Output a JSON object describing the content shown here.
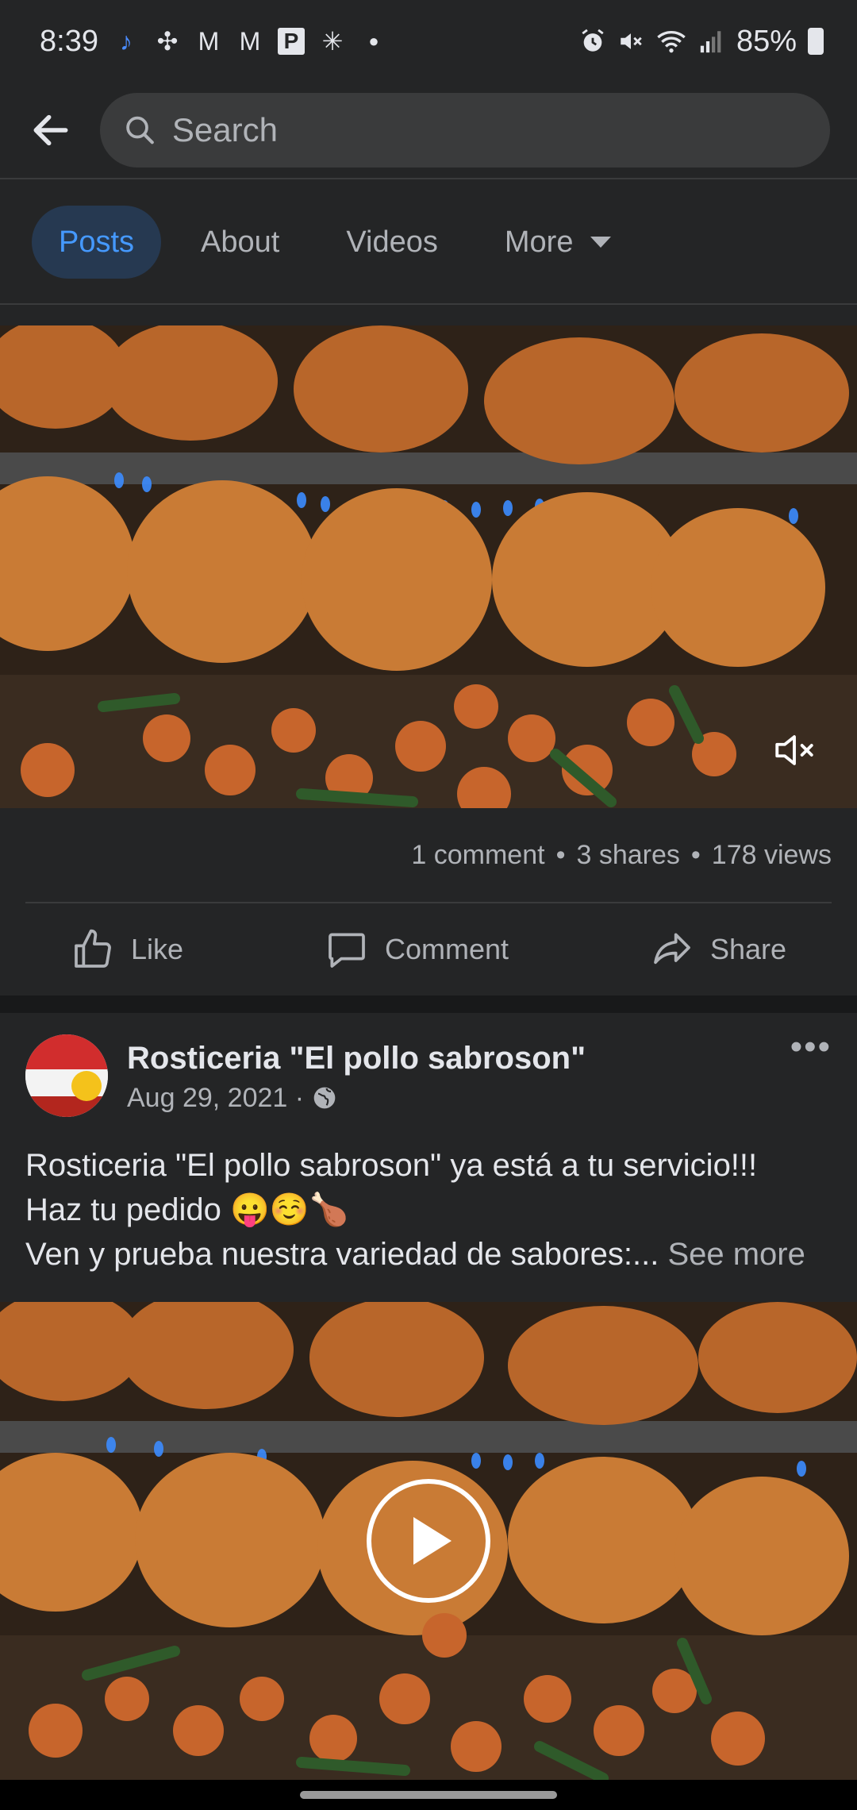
{
  "status_bar": {
    "time": "8:39",
    "battery": "85%",
    "left_icons": [
      "music-note-icon",
      "pinwheel-icon",
      "gmail-icon",
      "gmail-icon",
      "parking-icon",
      "walmart-spark-icon",
      "dot-icon"
    ],
    "right_icons": [
      "alarm-icon",
      "mute-icon",
      "wifi-icon",
      "signal-icon",
      "battery-icon"
    ]
  },
  "header": {
    "search_placeholder": "Search"
  },
  "tabs": [
    {
      "label": "Posts",
      "active": true
    },
    {
      "label": "About",
      "active": false
    },
    {
      "label": "Videos",
      "active": false
    },
    {
      "label": "More",
      "active": false
    }
  ],
  "post1": {
    "stats": {
      "comments": "1 comment",
      "shares": "3 shares",
      "views": "178 views",
      "separator": "•"
    },
    "actions": {
      "like": "Like",
      "comment": "Comment",
      "share": "Share"
    }
  },
  "post2": {
    "author": "Rosticeria \"El pollo sabroson\"",
    "date": "Aug 29, 2021 ·",
    "more": "•••",
    "text_line1": "Rosticeria \"El pollo sabroson\" ya está a tu servicio!!!",
    "text_line2": "Haz tu pedido 😛☺️🍗",
    "text_line3": "Ven y prueba nuestra variedad de sabores:...",
    "see_more": "See more"
  },
  "colors": {
    "background": "#242526",
    "accent": "#4599ff",
    "active_tab_bg": "#263951",
    "secondary_text": "#b0b3b8"
  }
}
